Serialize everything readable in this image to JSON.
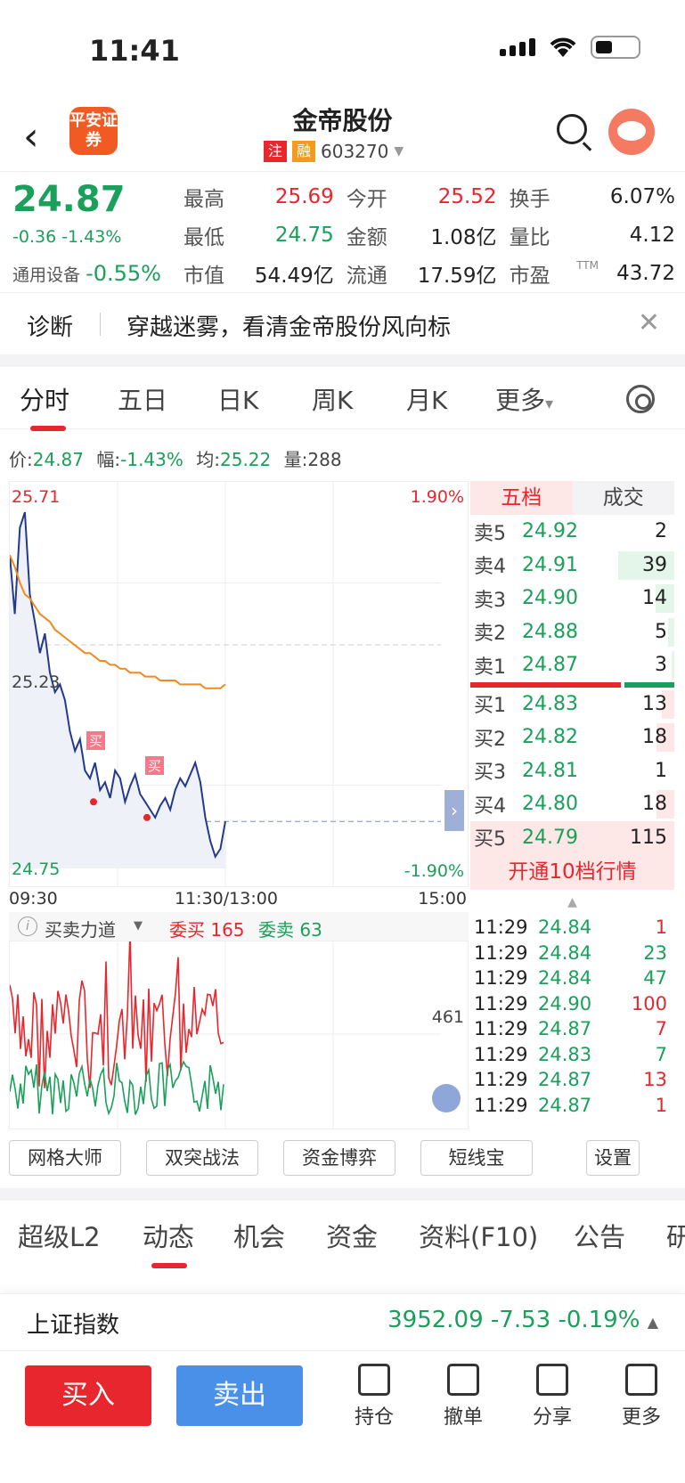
{
  "status": {
    "time": "11:41"
  },
  "header": {
    "title": "金帝股份",
    "tag1": "注",
    "tag2": "融",
    "code": "603270",
    "logo": "平安证券"
  },
  "quote": {
    "price": "24.87",
    "change": "-0.36 -1.43%",
    "sector_label": "通用设备",
    "sector_value": "-0.55%",
    "rows": [
      [
        {
          "l": "最高",
          "v": "25.69",
          "c": "red"
        },
        {
          "l": "今开",
          "v": "25.52",
          "c": "red"
        },
        {
          "l": "换手",
          "v": "6.07%",
          "c": "dark"
        }
      ],
      [
        {
          "l": "最低",
          "v": "24.75",
          "c": "green"
        },
        {
          "l": "金额",
          "v": "1.08亿",
          "c": "dark"
        },
        {
          "l": "量比",
          "v": "4.12",
          "c": "dark"
        }
      ],
      [
        {
          "l": "市值",
          "v": "54.49亿",
          "c": "dark"
        },
        {
          "l": "流通",
          "v": "17.59亿",
          "c": "dark"
        },
        {
          "l": "市盈",
          "v": "43.72",
          "c": "dark"
        }
      ]
    ],
    "pe_sup": "TTM"
  },
  "notice": {
    "label": "诊断",
    "text": "穿越迷雾，看清金帝股份风向标"
  },
  "chart_tabs": [
    "分时",
    "五日",
    "日K",
    "周K",
    "月K",
    "更多"
  ],
  "info": {
    "price_l": "价:",
    "price": "24.87",
    "amp_l": "幅:",
    "amp": "-1.43%",
    "avg_l": "均:",
    "avg": "25.22",
    "vol_l": "量:",
    "vol": "288"
  },
  "chart_labels": {
    "high": "25.71",
    "high_pct": "1.90%",
    "mid": "25.23",
    "low": "24.75",
    "low_pct": "-1.90%",
    "t1": "09:30",
    "t2": "11:30/13:00",
    "t3": "15:00",
    "buy_mark": "买"
  },
  "indicator": {
    "name": "买卖力道",
    "buy_label": "委买",
    "buy": "165",
    "sell_label": "委卖",
    "sell": "63",
    "right_val": "461"
  },
  "book": {
    "tabs": [
      "五档",
      "成交"
    ],
    "asks": [
      {
        "l": "卖5",
        "p": "24.92",
        "v": "2",
        "w": 0
      },
      {
        "l": "卖4",
        "p": "24.91",
        "v": "39",
        "w": 0.9
      },
      {
        "l": "卖3",
        "p": "24.90",
        "v": "14",
        "w": 0.3
      },
      {
        "l": "卖2",
        "p": "24.88",
        "v": "5",
        "w": 0.1
      },
      {
        "l": "卖1",
        "p": "24.87",
        "v": "3",
        "w": 0.05
      }
    ],
    "bids": [
      {
        "l": "买1",
        "p": "24.83",
        "v": "13",
        "w": 0.2
      },
      {
        "l": "买2",
        "p": "24.82",
        "v": "18",
        "w": 0.28
      },
      {
        "l": "买3",
        "p": "24.81",
        "v": "1",
        "w": 0
      },
      {
        "l": "买4",
        "p": "24.80",
        "v": "18",
        "w": 0.28
      },
      {
        "l": "买5",
        "p": "24.79",
        "v": "115",
        "w": 1
      }
    ],
    "open10": "开通10档行情",
    "ticks": [
      {
        "t": "11:29",
        "p": "24.84",
        "v": "1",
        "c": "red"
      },
      {
        "t": "11:29",
        "p": "24.84",
        "v": "23",
        "c": "green"
      },
      {
        "t": "11:29",
        "p": "24.84",
        "v": "47",
        "c": "green"
      },
      {
        "t": "11:29",
        "p": "24.90",
        "v": "100",
        "c": "red"
      },
      {
        "t": "11:29",
        "p": "24.87",
        "v": "7",
        "c": "red"
      },
      {
        "t": "11:29",
        "p": "24.83",
        "v": "7",
        "c": "green"
      },
      {
        "t": "11:29",
        "p": "24.87",
        "v": "13",
        "c": "red"
      },
      {
        "t": "11:29",
        "p": "24.87",
        "v": "1",
        "c": "red"
      }
    ]
  },
  "tools": [
    "网格大师",
    "双突战法",
    "资金博弈",
    "短线宝",
    "设置"
  ],
  "feed_tabs": [
    "超级L2",
    "动态",
    "机会",
    "资金",
    "资料(F10)",
    "公告",
    "研"
  ],
  "index": {
    "name": "上证指数",
    "value": "3952.09  -7.53  -0.19%"
  },
  "bottom": {
    "buy": "买入",
    "sell": "卖出",
    "actions": [
      "持仓",
      "撤单",
      "分享",
      "更多"
    ]
  },
  "chart_data": {
    "type": "line",
    "title": "",
    "ylim": [
      24.75,
      25.71
    ],
    "xlim": [
      "09:30",
      "15:00"
    ],
    "series": [
      {
        "values": [
          25.55,
          25.4,
          25.62,
          25.66,
          25.45,
          25.38,
          25.3,
          25.35,
          25.25,
          25.2,
          25.22,
          25.18,
          25.1,
          25.05,
          25.08,
          25.0,
          24.98,
          25.02,
          24.95,
          24.97,
          24.93,
          25.0,
          24.98,
          24.92,
          24.96,
          24.99,
          24.94,
          24.92,
          24.9,
          24.88,
          24.91,
          24.93,
          24.9,
          24.95,
          24.98,
          24.96,
          24.99,
          25.02,
          24.97,
          24.88,
          24.82,
          24.78,
          24.8,
          24.87
        ]
      },
      {
        "values": [
          25.55,
          25.52,
          25.48,
          25.45,
          25.44,
          25.42,
          25.4,
          25.39,
          25.38,
          25.36,
          25.35,
          25.34,
          25.33,
          25.32,
          25.31,
          25.3,
          25.3,
          25.29,
          25.28,
          25.28,
          25.27,
          25.27,
          25.26,
          25.26,
          25.25,
          25.25,
          25.25,
          25.24,
          25.24,
          25.24,
          25.23,
          25.23,
          25.23,
          25.23,
          25.22,
          25.22,
          25.22,
          25.22,
          25.22,
          25.21,
          25.21,
          25.21,
          25.21,
          25.22
        ]
      }
    ]
  }
}
